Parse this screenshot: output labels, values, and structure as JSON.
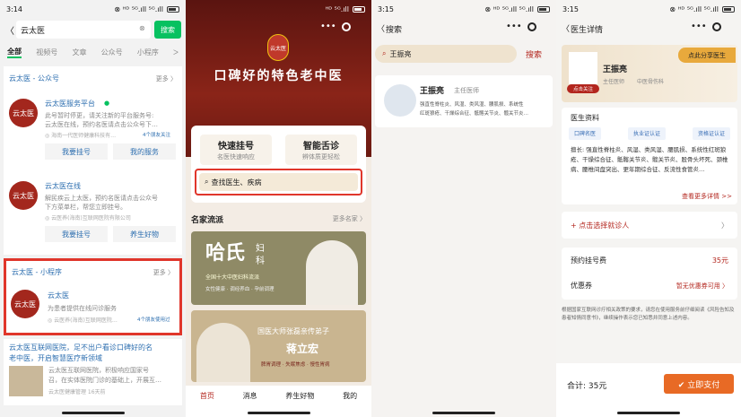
{
  "p1": {
    "time": "3:14",
    "status_right": "⊗ ᴴᴰ ⁵ᴳ.ıll ⁵ᴳ.ıll",
    "battery": "85",
    "search": {
      "value": "云太医",
      "button": "搜索"
    },
    "tabs": [
      "全部",
      "视频号",
      "文章",
      "公众号",
      "小程序",
      "ᐳ"
    ],
    "section1": {
      "title": "云太医 - 公众号",
      "more": "更多 〉"
    },
    "r1": {
      "name": "云太医服务平台",
      "desc1": "此号暂时停更，请关注新的平台服务号:",
      "desc2": "云太医在线，预约名医请点击公众号下…",
      "meta": "◎ 海南一代医师健康科技有…",
      "friends": "4个朋友关注",
      "btn1": "我要挂号",
      "btn2": "我的服务"
    },
    "r2": {
      "name": "云太医在线",
      "desc1": "解民疾云上太医，预约名医请点击公众号",
      "desc2": "下方菜单栏，帮您立即挂号。",
      "meta": "◎ 云医养(海南)互联网医院有限公司",
      "btn1": "我要挂号",
      "btn2": "养生好物"
    },
    "section2": {
      "title": "云太医 - 小程序",
      "more": "更多 〉"
    },
    "r3": {
      "name": "云太医",
      "desc": "为患者提供在线问诊服务",
      "meta": "◎ 云医养(海南)互联网医院…",
      "friends": "4个朋友使用过"
    },
    "art": {
      "title1": "云太医互联网医院，足不出户看诊口碑好的名",
      "title2": "老中医，开启智慧医疗新领域",
      "d1": "云太医互联网医院，积极响应国家号",
      "d2": "召，在实体医院门诊的基础上，开展互…",
      "meta": "云太医健康管理 16天前"
    },
    "logo": "云太医"
  },
  "p2": {
    "status_right": "ᴴᴰ ⁵ᴳ.ıll",
    "banner": "口碑好的特色老中医",
    "logo": "云太医",
    "quick": {
      "t": "快速挂号",
      "s": "名医快速响应"
    },
    "tongue": {
      "t": "智能舌诊",
      "s": "辨体质更轻松"
    },
    "search": "查找医生、疾病",
    "section": "名家流派",
    "more": "更多名家 〉",
    "ad1": {
      "big": "哈氏",
      "small1": "妇",
      "small2": "科",
      "sub": "全国十大中医妇科流派",
      "tags": "女性健康 · 调经养血 · 孕前调理"
    },
    "ad2": {
      "line": "国医大师张磊亲传弟子",
      "name": "蒋立宏",
      "tags": "脾胃调理 · 失眠焦虑 · 慢性胃病"
    },
    "nav": [
      "首页",
      "消息",
      "养生好物",
      "我的"
    ]
  },
  "p3": {
    "time": "3:15",
    "status_right": "⊗ ᴴᴰ ⁵ᴳ.ıll ⁵ᴳ.ıll",
    "title": "搜索",
    "search": "王振亮",
    "search_btn": "搜索",
    "doc": {
      "name": "王振亮",
      "title": "主任医师",
      "d1": "强直性脊柱炎、风湿、类风湿、腰肌损、系统性",
      "d2": "红斑狼疮、干燥综合征、骶髂关节炎、髋关节炎…"
    }
  },
  "p4": {
    "time": "3:15",
    "status_right": "⊗ ᴴᴰ ⁵ᴳ.ıll ⁵ᴳ.ıll",
    "title": "医生详情",
    "share": "点此分享医生",
    "doc": {
      "name": "王振亮",
      "title": "主任医师",
      "dept": "中医骨伤科",
      "badge": "点击关注"
    },
    "profile_label": "医生资料",
    "tags": [
      "口碑名医",
      "执业证认证",
      "资格证认证"
    ],
    "skill": "擅长: 强直性脊柱炎、风湿、类风湿、腰肌损、系统性红斑狼疮、干燥综合征、骶髂关节炎、髋关节炎、股骨头坏死、颈椎病、腰椎间盘突出、更年期综合征、反流性食管炎…",
    "more": "查看更多详情 >>",
    "choose": "+ 点击选择就诊人",
    "fee_label": "预约挂号费",
    "fee": "35元",
    "coupon_label": "优惠券",
    "coupon": "暂无优惠券可用 〉",
    "notice": "根据国家互联网诊疗相关政策的要求，请您在使用服务前仔细阅读《风险告知及患者知情同意书》，继续操作表示您已知悉并同意上述内容。",
    "total": "合计: 35元",
    "pay": "✔ 立即支付"
  }
}
